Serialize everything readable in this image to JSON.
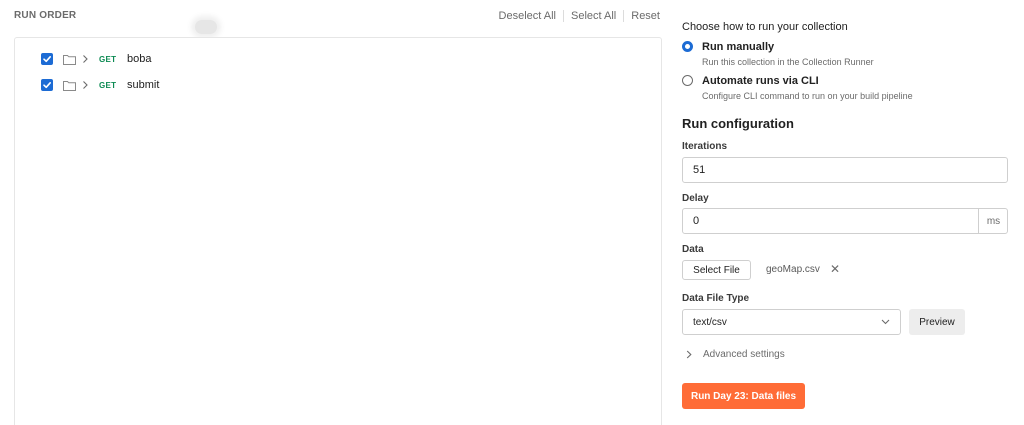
{
  "run_order": {
    "title": "RUN ORDER",
    "deselect_all": "Deselect All",
    "select_all": "Select All",
    "reset": "Reset",
    "requests": [
      {
        "checked": true,
        "method": "GET",
        "name": "boba"
      },
      {
        "checked": true,
        "method": "GET",
        "name": "submit"
      }
    ]
  },
  "run_mode": {
    "heading": "Choose how to run your collection",
    "options": [
      {
        "title": "Run manually",
        "subtitle": "Run this collection in the Collection Runner",
        "selected": true
      },
      {
        "title": "Automate runs via CLI",
        "subtitle": "Configure CLI command to run on your build pipeline",
        "selected": false
      }
    ]
  },
  "config": {
    "title": "Run configuration",
    "iterations_label": "Iterations",
    "iterations_value": "51",
    "delay_label": "Delay",
    "delay_value": "0",
    "delay_unit": "ms",
    "data_label": "Data",
    "select_file_label": "Select File",
    "file_name": "geoMap.csv",
    "data_file_type_label": "Data File Type",
    "data_file_type_value": "text/csv",
    "preview_label": "Preview",
    "advanced_settings_label": "Advanced settings",
    "run_button_label": "Run Day 23: Data files"
  },
  "colors": {
    "accent_blue": "#1c6bd4",
    "method_get": "#0b8a52",
    "run_orange": "#ff6c37"
  },
  "icons": {
    "checkbox": "checkmark-icon",
    "folder": "folder-icon",
    "expand": "chevron-right-icon",
    "remove_file": "close-icon",
    "dropdown": "chevron-down-icon"
  }
}
